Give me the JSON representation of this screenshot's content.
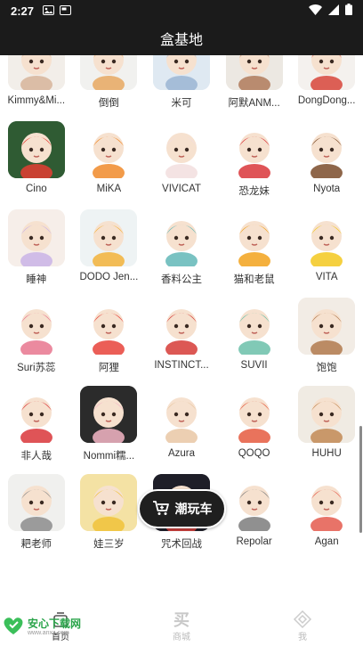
{
  "status_bar": {
    "time": "2:27"
  },
  "app_bar": {
    "title": "盒基地"
  },
  "brands": [
    {
      "label": "Kimmy&Mi...",
      "bg": "#f2eee9",
      "accent": "#d7b49a"
    },
    {
      "label": "倒倒",
      "bg": "#f1f1ef",
      "accent": "#e7a860"
    },
    {
      "label": "米可",
      "bg": "#dfe9f2",
      "accent": "#9bb5d4"
    },
    {
      "label": "阿默ANM...",
      "bg": "#ece8e2",
      "accent": "#b07a5a"
    },
    {
      "label": "DongDong...",
      "bg": "#f4f1ee",
      "accent": "#d7453a"
    },
    {
      "label": "Cino",
      "bg": "#2f5b33",
      "accent": "#e43d32"
    },
    {
      "label": "MiKA",
      "bg": "#ffffff",
      "accent": "#f08a2a"
    },
    {
      "label": "VIVICAT",
      "bg": "#ffffff",
      "accent": "#f2dede"
    },
    {
      "label": "恐龙妹",
      "bg": "#ffffff",
      "accent": "#d9363a"
    },
    {
      "label": "Nyota",
      "bg": "#ffffff",
      "accent": "#7a4b2a"
    },
    {
      "label": "睡神",
      "bg": "#f6eee9",
      "accent": "#c9b3e6"
    },
    {
      "label": "DODO Jen...",
      "bg": "#eef3f4",
      "accent": "#f2b13a"
    },
    {
      "label": "香料公主",
      "bg": "#ffffff",
      "accent": "#62b7b7"
    },
    {
      "label": "猫和老鼠",
      "bg": "#ffffff",
      "accent": "#f2a21c"
    },
    {
      "label": "VITA",
      "bg": "#ffffff",
      "accent": "#f3c81f"
    },
    {
      "label": "Suri苏蕊",
      "bg": "#ffffff",
      "accent": "#e8768e"
    },
    {
      "label": "阿狸",
      "bg": "#ffffff",
      "accent": "#e8423a"
    },
    {
      "label": "INSTINCT...",
      "bg": "#ffffff",
      "accent": "#d63b36"
    },
    {
      "label": "SUVII",
      "bg": "#ffffff",
      "accent": "#6bbfa9"
    },
    {
      "label": "饱饱",
      "bg": "#f2ece5",
      "accent": "#b27a4e"
    },
    {
      "label": "非人哉",
      "bg": "#ffffff",
      "accent": "#d9363a"
    },
    {
      "label": "Nommi糯...",
      "bg": "#2b2b2b",
      "accent": "#f4b6c6"
    },
    {
      "label": "Azura",
      "bg": "#ffffff",
      "accent": "#e9c7a4"
    },
    {
      "label": "QOQO",
      "bg": "#ffffff",
      "accent": "#e55b40"
    },
    {
      "label": "HUHU",
      "bg": "#f0ebe3",
      "accent": "#c28a55"
    },
    {
      "label": "耙老师",
      "bg": "#f0f0ee",
      "accent": "#8c8c8c"
    },
    {
      "label": "娃三岁",
      "bg": "#f4e2a4",
      "accent": "#f0c23a"
    },
    {
      "label": "咒术回战",
      "bg": "#1e1e28",
      "accent": "#e7453f"
    },
    {
      "label": "Repolar",
      "bg": "#ffffff",
      "accent": "#7d7d7d"
    },
    {
      "label": "Agan",
      "bg": "#ffffff",
      "accent": "#e45b4d"
    }
  ],
  "cart_button": {
    "label": "潮玩车"
  },
  "bottom_nav": [
    {
      "label": "首页",
      "icon": "home-icon"
    },
    {
      "label": "商城",
      "icon": "shop-icon"
    },
    {
      "label": "我",
      "icon": "profile-icon"
    }
  ],
  "watermark": {
    "logo": "安心下载网",
    "sub": "www.anxz.com"
  }
}
